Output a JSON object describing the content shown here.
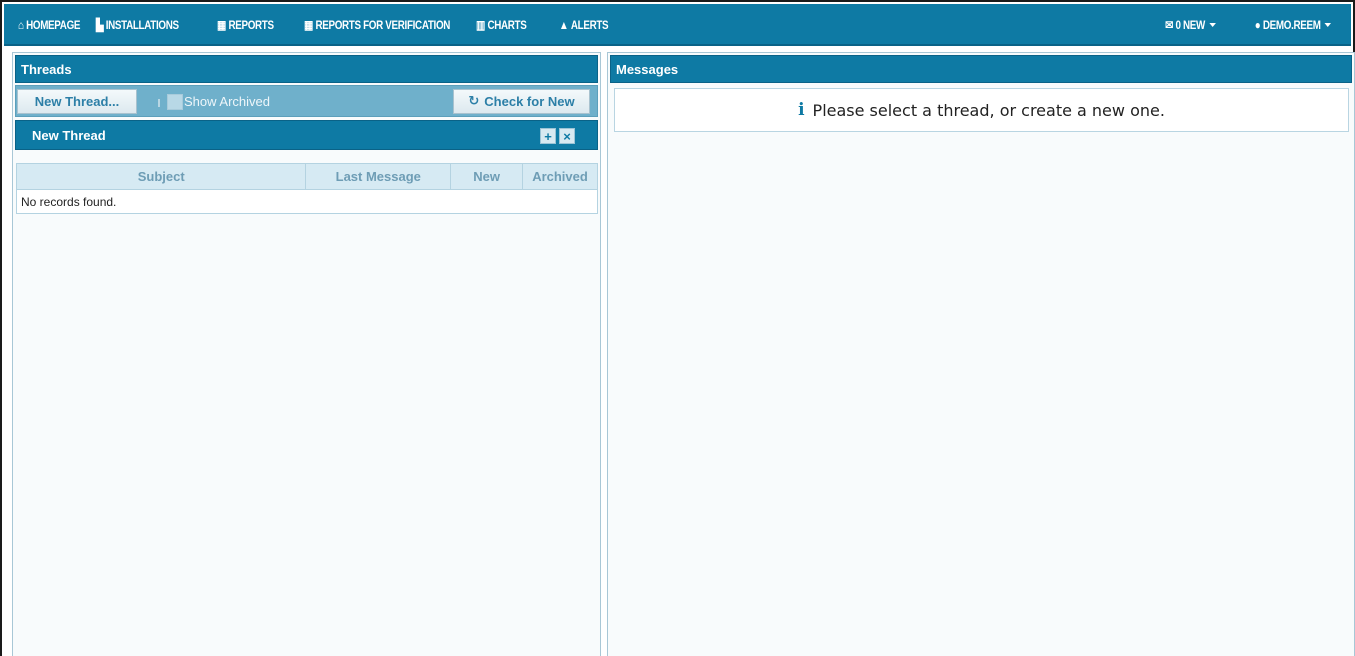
{
  "nav": {
    "left": [
      {
        "id": "homepage",
        "icon": "home-icon",
        "glyph": "⌂",
        "label": "HOMEPAGE"
      },
      {
        "id": "installations",
        "icon": "industry-icon",
        "glyph": "▙",
        "label": "INSTALLATIONS"
      },
      {
        "id": "reports",
        "icon": "calendar-icon",
        "glyph": "▦",
        "label": "REPORTS"
      },
      {
        "id": "reports-verification",
        "icon": "calendar-icon",
        "glyph": "▦",
        "label": "REPORTS FOR VERIFICATION"
      },
      {
        "id": "charts",
        "icon": "bar-chart-icon",
        "glyph": "▥",
        "label": "CHARTS"
      },
      {
        "id": "alerts",
        "icon": "warning-icon",
        "glyph": "▲",
        "label": "ALERTS"
      }
    ],
    "right": [
      {
        "id": "messages",
        "icon": "envelope-icon",
        "glyph": "✉",
        "label": "0 NEW"
      },
      {
        "id": "user",
        "icon": "user-icon",
        "glyph": "●",
        "label": "DEMO.REEM"
      }
    ]
  },
  "threads": {
    "title": "Threads",
    "new_thread_button": "New Thread...",
    "show_archived_label": "Show Archived",
    "check_new_button": "Check for New",
    "check_new_icon": "refresh-icon",
    "new_thread_section": "New Thread",
    "columns": [
      "Subject",
      "Last Message",
      "New",
      "Archived"
    ],
    "empty_text": "No records found."
  },
  "messages": {
    "title": "Messages",
    "info_icon": "info-icon",
    "info_text": "Please select a thread, or create a new one."
  },
  "colors": {
    "primary": "#0e7aa4",
    "toolbar": "#6fb0cb",
    "table_header": "#d6eaf3"
  }
}
